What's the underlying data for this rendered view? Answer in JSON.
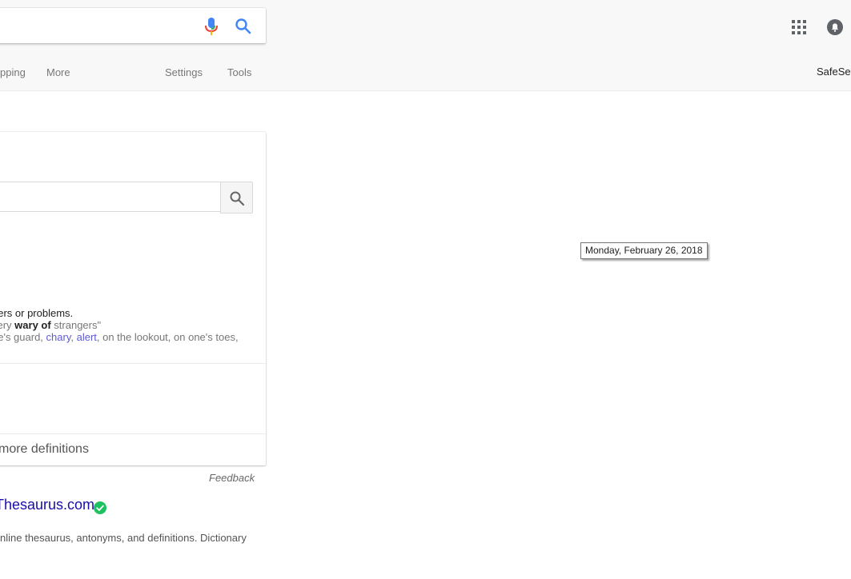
{
  "header": {
    "nav": {
      "shopping_partial": "pping",
      "more": "More",
      "settings": "Settings",
      "tools": "Tools"
    },
    "safesearch_partial": "SafeSea"
  },
  "dictionary_card": {
    "definition": "gers or problems.",
    "example": {
      "prefix": "very ",
      "bold": "wary of",
      "suffix": " strangers\""
    },
    "synonyms": {
      "prefix": "ne's guard, ",
      "link1": "chary",
      "sep": ", ",
      "link2": "alert",
      "suffix": ", on the lookout, on one's toes,"
    },
    "more_definitions": "l more definitions"
  },
  "feedback": "Feedback",
  "result": {
    "title": "Thesaurus.com",
    "snippet": "nline thesaurus, antonyms, and definitions. Dictionary"
  },
  "tooltip": "Monday, February 26, 2018",
  "colors": {
    "link": "#1a0dab",
    "synonym_link": "#5e5ad6",
    "verified": "#1ec15f",
    "mic_blue": "#4285f4",
    "mic_red": "#ea4335"
  },
  "icons": [
    "mic-icon",
    "search-icon",
    "apps-grid-icon",
    "notifications-bell-icon",
    "verified-check-icon"
  ]
}
